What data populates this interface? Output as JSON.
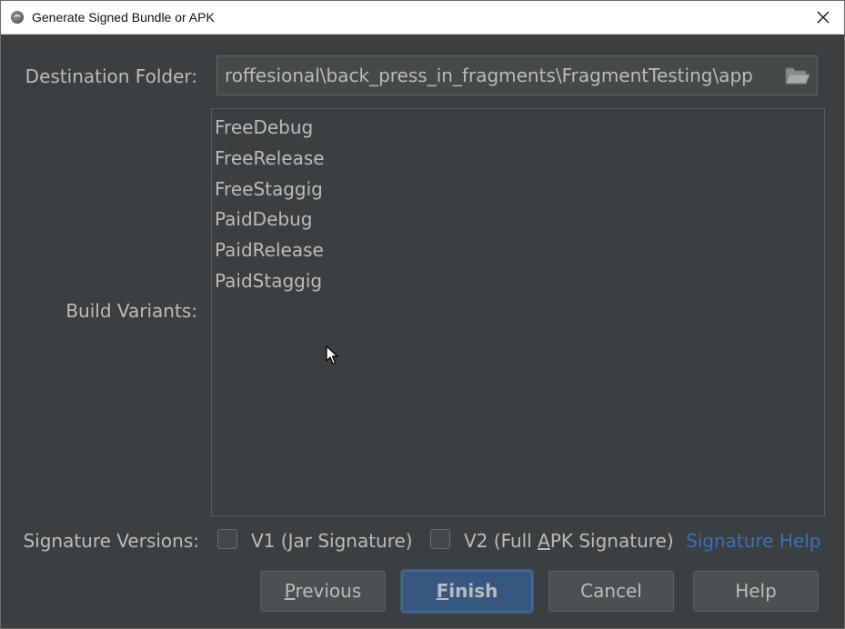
{
  "window": {
    "title": "Generate Signed Bundle or APK"
  },
  "destination": {
    "label": "Destination Folder:",
    "value": "roffesional\\back_press_in_fragments\\FragmentTesting\\app"
  },
  "build_variants": {
    "label": "Build Variants:",
    "items": [
      {
        "label": "FreeDebug"
      },
      {
        "label": "FreeRelease"
      },
      {
        "label": "FreeStaggig"
      },
      {
        "label": "PaidDebug"
      },
      {
        "label": "PaidRelease"
      },
      {
        "label": "PaidStaggig"
      }
    ]
  },
  "signature": {
    "label": "Signature Versions:",
    "v1": {
      "label_pre": "V1 (",
      "label_mnemonic": "J",
      "label_post": "ar Signature)",
      "checked": false
    },
    "v2": {
      "label_pre": "V2 (Full ",
      "label_mnemonic": "A",
      "label_post": "PK Signature)",
      "checked": false
    },
    "help_link": "Signature Help"
  },
  "buttons": {
    "previous": {
      "mnemonic": "P",
      "rest": "revious"
    },
    "finish": {
      "mnemonic": "F",
      "rest": "inish"
    },
    "cancel": "Cancel",
    "help": "Help"
  },
  "colors": {
    "background": "#3c3f41",
    "text": "#bbbbbb",
    "link": "#3c6fb4",
    "default_button": "#365880"
  },
  "icons": {
    "app": "android-studio-icon",
    "close": "close-icon",
    "folder": "folder-open-icon",
    "cursor": "mouse-pointer-icon"
  }
}
